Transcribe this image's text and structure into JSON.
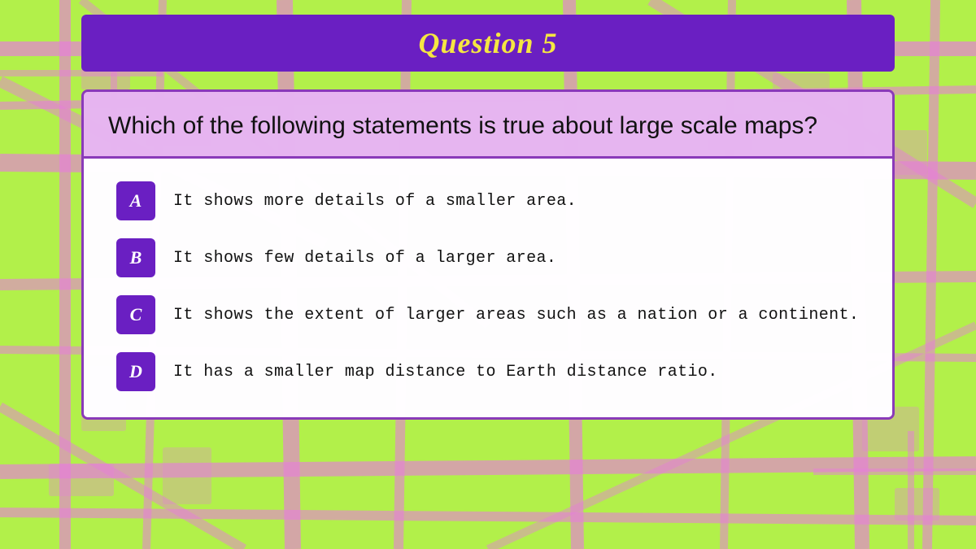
{
  "header": {
    "title": "Question 5"
  },
  "question": {
    "text": "Which of the following statements is true about large scale maps?"
  },
  "answers": [
    {
      "label": "A",
      "text": "It shows more details of a smaller area."
    },
    {
      "label": "B",
      "text": "It shows few details of a larger area."
    },
    {
      "label": "C",
      "text": "It shows the extent of larger areas such as a nation or a continent."
    },
    {
      "label": "D",
      "text": "It has a smaller map distance to Earth distance ratio."
    }
  ],
  "colors": {
    "background": "#b2f04a",
    "banner_bg": "#6a1fc2",
    "banner_text": "#f5e642",
    "badge_bg": "#6a1fc2",
    "card_border": "#8a3ab9",
    "card_bg": "#e6b4f0",
    "answer_bg": "#ffffff"
  }
}
